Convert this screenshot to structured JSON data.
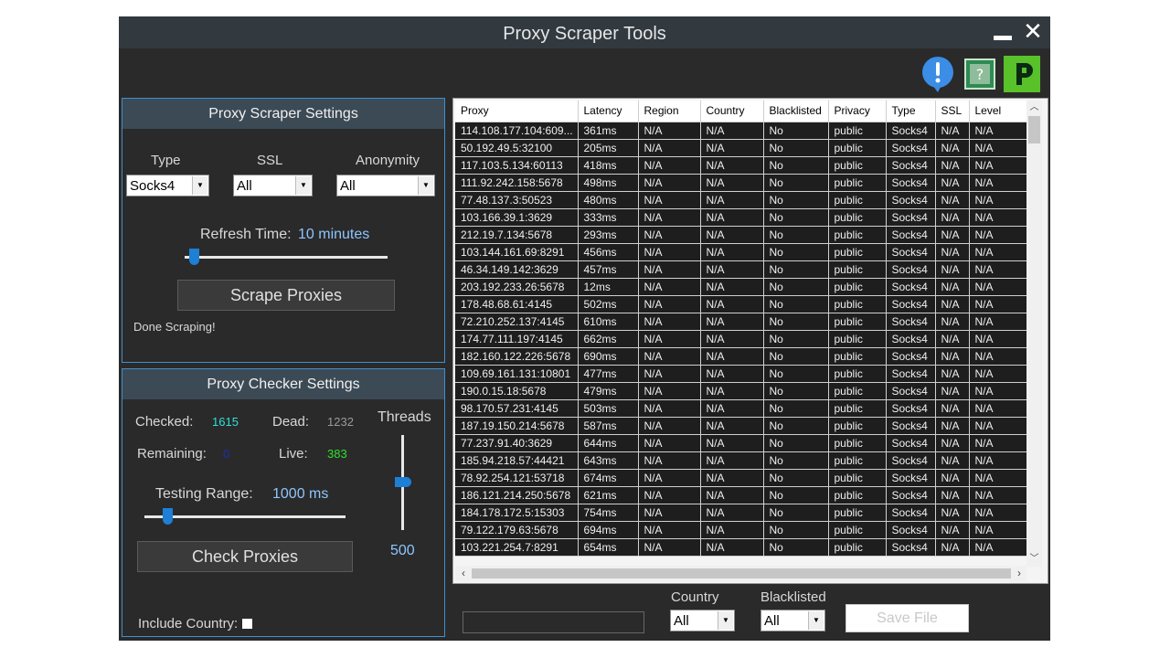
{
  "window": {
    "title": "Proxy Scraper Tools"
  },
  "icons": {
    "alert": "exclamation-icon",
    "help": "chip-help-icon",
    "vpn": "ipvanish-logo-icon"
  },
  "scraper": {
    "header": "Proxy Scraper Settings",
    "type_label": "Type",
    "ssl_label": "SSL",
    "anonymity_label": "Anonymity",
    "type_value": "Socks4",
    "ssl_value": "All",
    "anonymity_value": "All",
    "refresh_label": "Refresh Time:",
    "refresh_value": "10 minutes",
    "scrape_button": "Scrape Proxies",
    "status": "Done Scraping!"
  },
  "checker": {
    "header": "Proxy Checker Settings",
    "checked_label": "Checked:",
    "checked_value": "1615",
    "dead_label": "Dead:",
    "dead_value": "1232",
    "remaining_label": "Remaining:",
    "remaining_value": "0",
    "live_label": "Live:",
    "live_value": "383",
    "threads_label": "Threads",
    "threads_value": "500",
    "range_label": "Testing Range:",
    "range_value": "1000 ms",
    "check_button": "Check Proxies",
    "include_country_label": "Include Country:"
  },
  "filters": {
    "country_label": "Country",
    "country_value": "All",
    "blacklisted_label": "Blacklisted",
    "blacklisted_value": "All",
    "save_button": "Save File"
  },
  "table": {
    "columns": [
      "Proxy",
      "Latency",
      "Region",
      "Country",
      "Blacklisted",
      "Privacy",
      "Type",
      "SSL",
      "Level"
    ],
    "rows": [
      [
        "114.108.177.104:609...",
        "361ms",
        "N/A",
        "N/A",
        "No",
        "public",
        "Socks4",
        "N/A",
        "N/A"
      ],
      [
        "50.192.49.5:32100",
        "205ms",
        "N/A",
        "N/A",
        "No",
        "public",
        "Socks4",
        "N/A",
        "N/A"
      ],
      [
        "117.103.5.134:60113",
        "418ms",
        "N/A",
        "N/A",
        "No",
        "public",
        "Socks4",
        "N/A",
        "N/A"
      ],
      [
        "111.92.242.158:5678",
        "498ms",
        "N/A",
        "N/A",
        "No",
        "public",
        "Socks4",
        "N/A",
        "N/A"
      ],
      [
        "77.48.137.3:50523",
        "480ms",
        "N/A",
        "N/A",
        "No",
        "public",
        "Socks4",
        "N/A",
        "N/A"
      ],
      [
        "103.166.39.1:3629",
        "333ms",
        "N/A",
        "N/A",
        "No",
        "public",
        "Socks4",
        "N/A",
        "N/A"
      ],
      [
        "212.19.7.134:5678",
        "293ms",
        "N/A",
        "N/A",
        "No",
        "public",
        "Socks4",
        "N/A",
        "N/A"
      ],
      [
        "103.144.161.69:8291",
        "456ms",
        "N/A",
        "N/A",
        "No",
        "public",
        "Socks4",
        "N/A",
        "N/A"
      ],
      [
        "46.34.149.142:3629",
        "457ms",
        "N/A",
        "N/A",
        "No",
        "public",
        "Socks4",
        "N/A",
        "N/A"
      ],
      [
        "203.192.233.26:5678",
        "12ms",
        "N/A",
        "N/A",
        "No",
        "public",
        "Socks4",
        "N/A",
        "N/A"
      ],
      [
        "178.48.68.61:4145",
        "502ms",
        "N/A",
        "N/A",
        "No",
        "public",
        "Socks4",
        "N/A",
        "N/A"
      ],
      [
        "72.210.252.137:4145",
        "610ms",
        "N/A",
        "N/A",
        "No",
        "public",
        "Socks4",
        "N/A",
        "N/A"
      ],
      [
        "174.77.111.197:4145",
        "662ms",
        "N/A",
        "N/A",
        "No",
        "public",
        "Socks4",
        "N/A",
        "N/A"
      ],
      [
        "182.160.122.226:5678",
        "690ms",
        "N/A",
        "N/A",
        "No",
        "public",
        "Socks4",
        "N/A",
        "N/A"
      ],
      [
        "109.69.161.131:10801",
        "477ms",
        "N/A",
        "N/A",
        "No",
        "public",
        "Socks4",
        "N/A",
        "N/A"
      ],
      [
        "190.0.15.18:5678",
        "479ms",
        "N/A",
        "N/A",
        "No",
        "public",
        "Socks4",
        "N/A",
        "N/A"
      ],
      [
        "98.170.57.231:4145",
        "503ms",
        "N/A",
        "N/A",
        "No",
        "public",
        "Socks4",
        "N/A",
        "N/A"
      ],
      [
        "187.19.150.214:5678",
        "587ms",
        "N/A",
        "N/A",
        "No",
        "public",
        "Socks4",
        "N/A",
        "N/A"
      ],
      [
        "77.237.91.40:3629",
        "644ms",
        "N/A",
        "N/A",
        "No",
        "public",
        "Socks4",
        "N/A",
        "N/A"
      ],
      [
        "185.94.218.57:44421",
        "643ms",
        "N/A",
        "N/A",
        "No",
        "public",
        "Socks4",
        "N/A",
        "N/A"
      ],
      [
        "78.92.254.121:53718",
        "674ms",
        "N/A",
        "N/A",
        "No",
        "public",
        "Socks4",
        "N/A",
        "N/A"
      ],
      [
        "186.121.214.250:5678",
        "621ms",
        "N/A",
        "N/A",
        "No",
        "public",
        "Socks4",
        "N/A",
        "N/A"
      ],
      [
        "184.178.172.5:15303",
        "754ms",
        "N/A",
        "N/A",
        "No",
        "public",
        "Socks4",
        "N/A",
        "N/A"
      ],
      [
        "79.122.179.63:5678",
        "694ms",
        "N/A",
        "N/A",
        "No",
        "public",
        "Socks4",
        "N/A",
        "N/A"
      ],
      [
        "103.221.254.7:8291",
        "654ms",
        "N/A",
        "N/A",
        "No",
        "public",
        "Socks4",
        "N/A",
        "N/A"
      ]
    ]
  }
}
